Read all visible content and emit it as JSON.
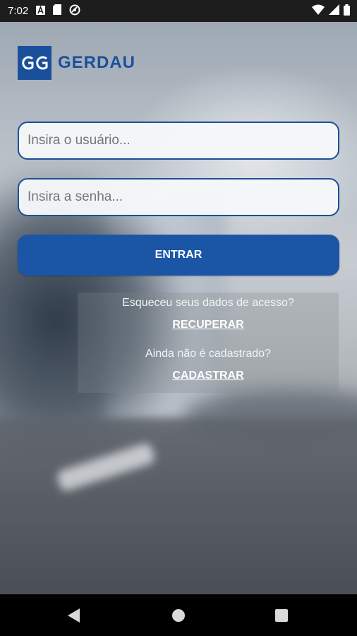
{
  "status_bar": {
    "time": "7:02",
    "icons_left": [
      "a-icon",
      "sim-card-icon",
      "sync-icon"
    ],
    "icons_right": [
      "wifi-icon",
      "signal-icon",
      "battery-icon"
    ]
  },
  "logo": {
    "mark": "GG",
    "brand": "GERDAU"
  },
  "login": {
    "user_placeholder": "Insira o usuário...",
    "password_placeholder": "Insira a senha...",
    "submit_label": "ENTRAR"
  },
  "help": {
    "forgot_question": "Esqueceu seus dados de acesso?",
    "recover_link": "RECUPERAR",
    "register_question": "Ainda não é cadastrado?",
    "register_link": "CADASTRAR"
  },
  "colors": {
    "brand_blue": "#1a4f9c",
    "button_blue": "#1b56a6"
  }
}
